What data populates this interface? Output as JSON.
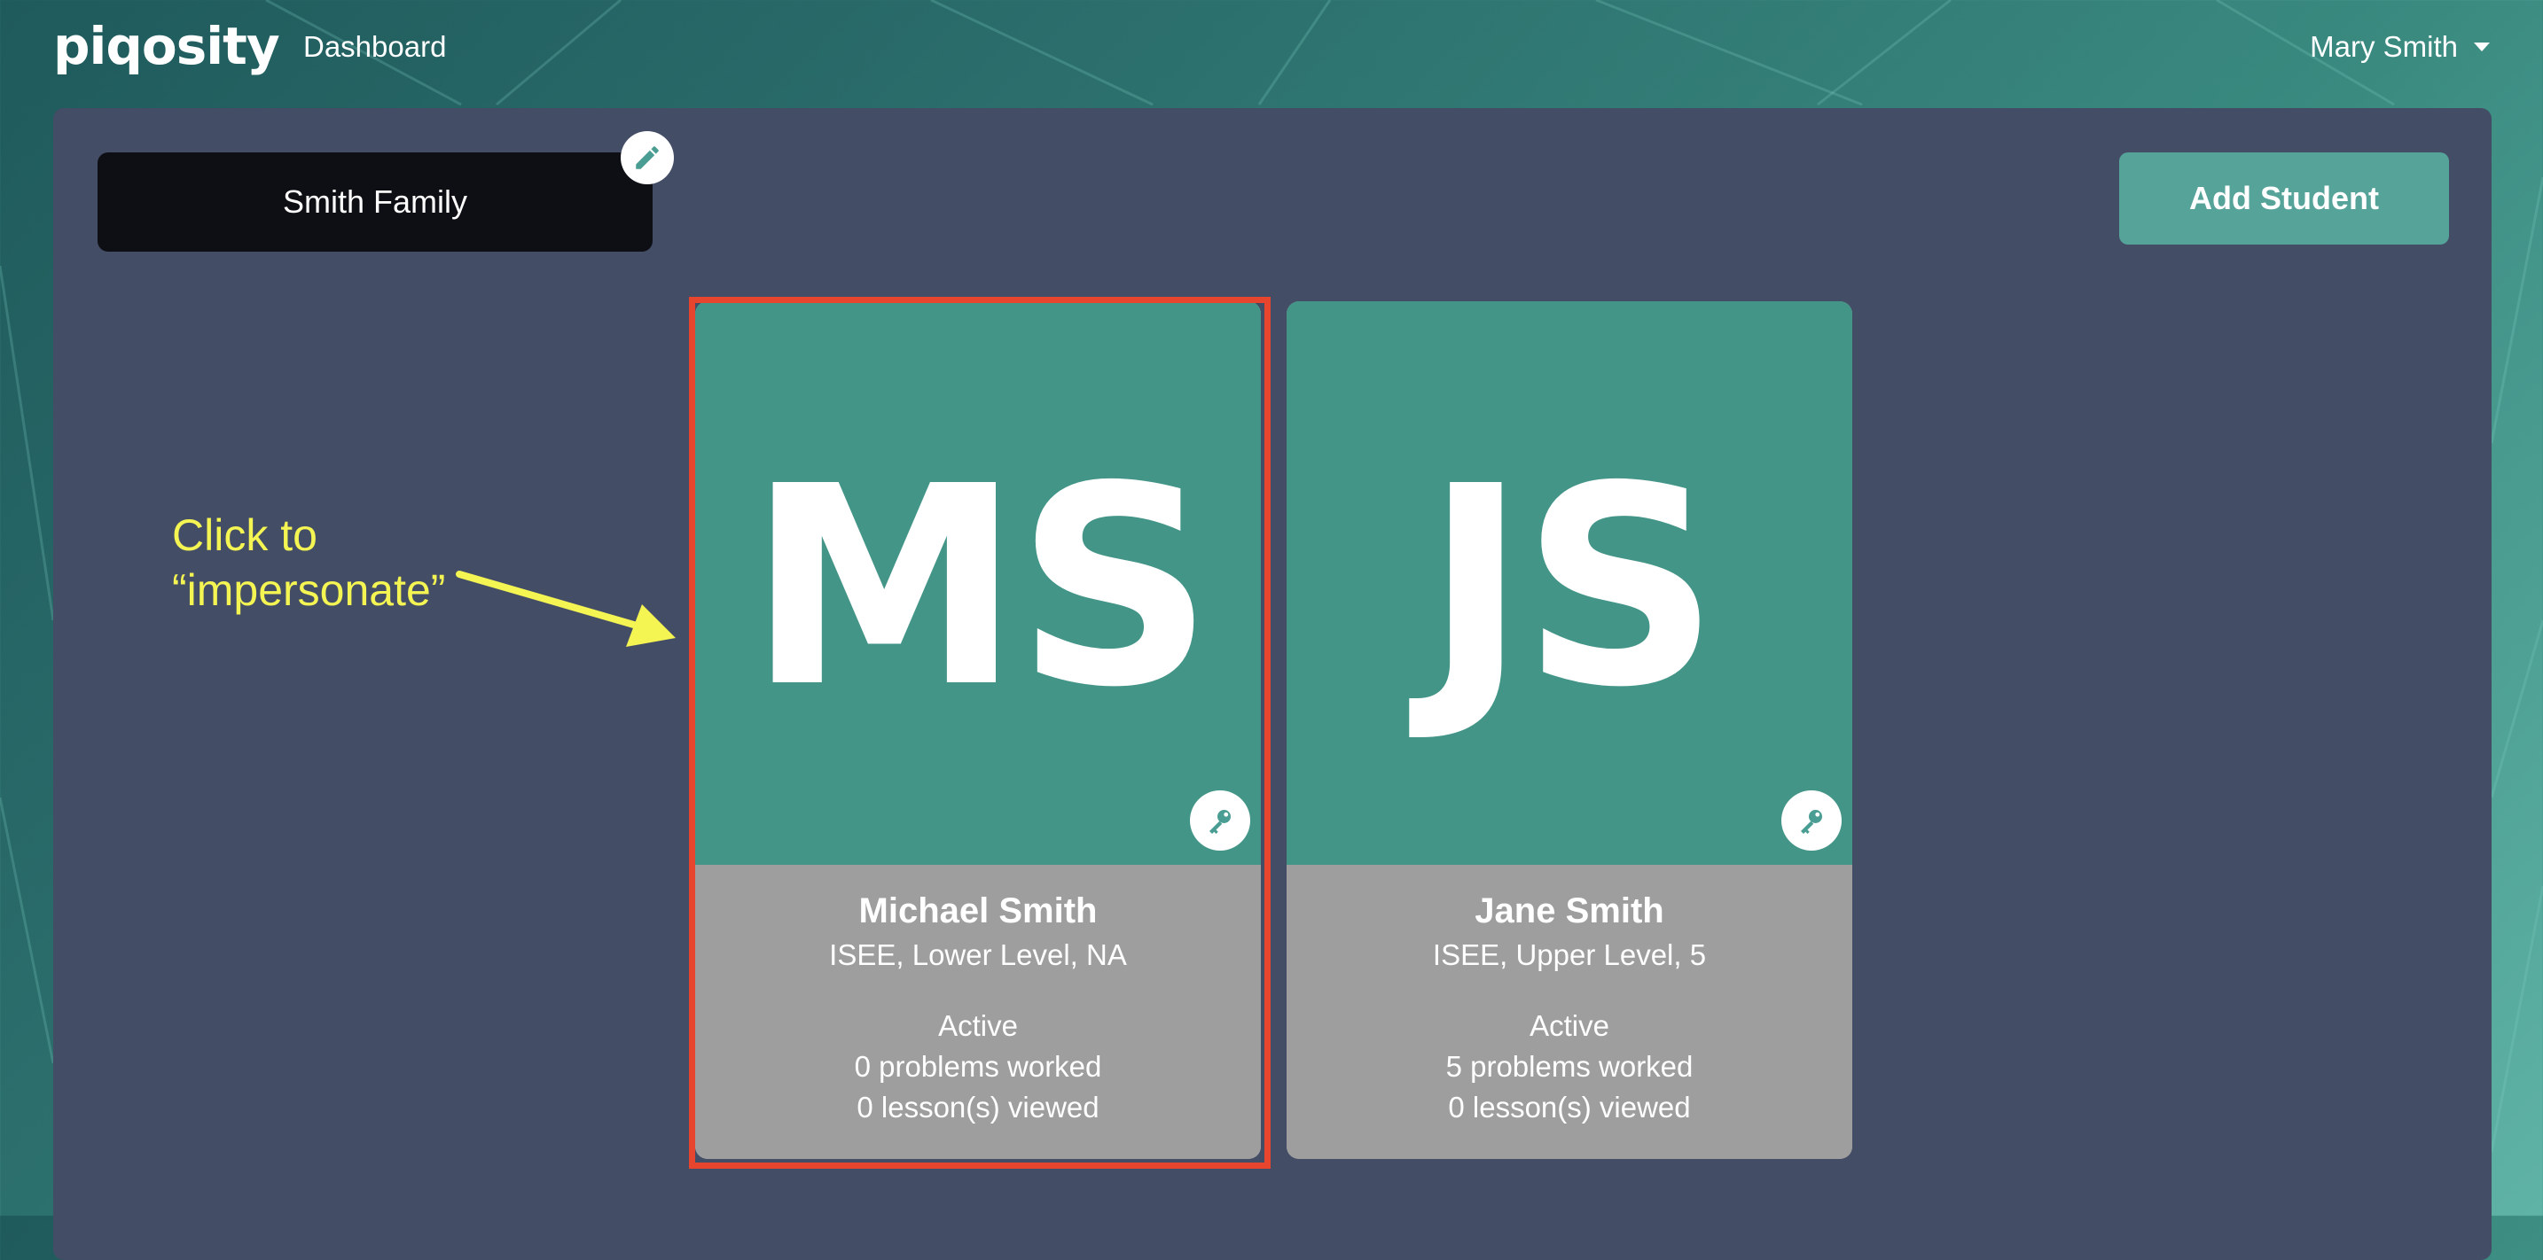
{
  "navbar": {
    "logo": "piqosity",
    "dashboard_label": "Dashboard",
    "user_name": "Mary Smith"
  },
  "family": {
    "name": "Smith Family"
  },
  "actions": {
    "add_student_label": "Add Student"
  },
  "annotation": {
    "line1": "Click to",
    "line2": "“impersonate”"
  },
  "students": [
    {
      "initials": "MS",
      "name": "Michael Smith",
      "level": "ISEE, Lower Level, NA",
      "status": "Active",
      "problems": "0 problems worked",
      "lessons": "0 lesson(s) viewed"
    },
    {
      "initials": "JS",
      "name": "Jane Smith",
      "level": "ISEE, Upper Level, 5",
      "status": "Active",
      "problems": "5 problems worked",
      "lessons": "0 lesson(s) viewed"
    }
  ],
  "icons": {
    "edit": "pencil-icon",
    "key": "key-icon",
    "caret": "caret-down-icon"
  },
  "colors": {
    "card_top": "#439588",
    "card_bottom": "#9e9e9e",
    "panel": "#434d66",
    "accent_button": "#56a39a",
    "highlight": "#e8452f",
    "annotation": "#f4f453"
  }
}
